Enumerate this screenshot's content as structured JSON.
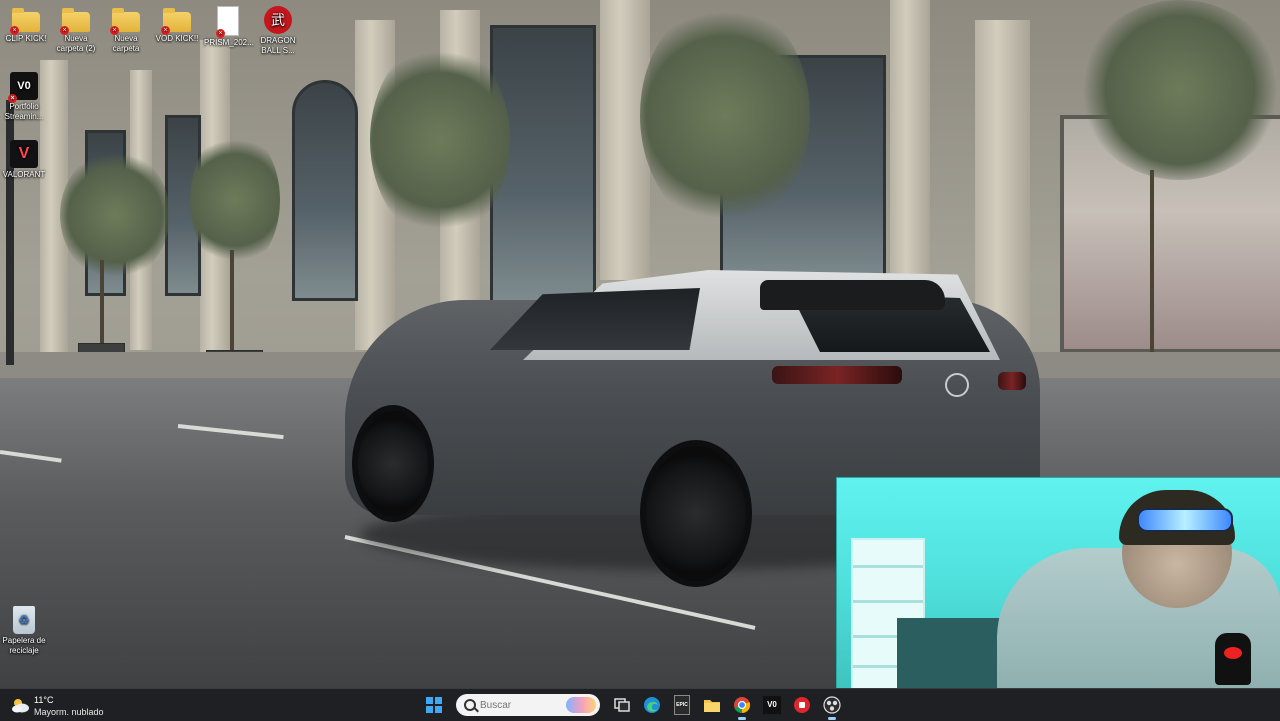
{
  "desktop": {
    "icons": [
      {
        "label": "CLIP KICK!",
        "type": "folder"
      },
      {
        "label": "Nueva carpeta (2)",
        "type": "folder"
      },
      {
        "label": "Nueva carpeta",
        "type": "folder"
      },
      {
        "label": "VOD KICK!!",
        "type": "folder"
      },
      {
        "label": "PRISM_202...",
        "type": "document"
      },
      {
        "label": "DRAGON BALL S...",
        "type": "app"
      },
      {
        "label": "Portfolio Streamin...",
        "type": "app"
      },
      {
        "label": "VALORANT",
        "type": "app"
      },
      {
        "label": "Papelera de reciclaje",
        "type": "recycle-bin"
      }
    ],
    "icon_glyphs": {
      "portfolio": "V0",
      "dragon": "武",
      "valorant": "V",
      "bin": "♻"
    }
  },
  "taskbar": {
    "weather": {
      "temp": "11°C",
      "condition": "Mayorm. nublado"
    },
    "search": {
      "placeholder": "Buscar"
    },
    "apps": [
      "task-view",
      "edge",
      "epic-games",
      "file-explorer",
      "chrome",
      "portfolio-streaming",
      "record-app",
      "obs"
    ],
    "epic_label": "EPIC"
  },
  "colors": {
    "taskbar_bg": "#1c1e21",
    "webcam_bg": "#5ff2ee",
    "accent": "#3fa9f5"
  }
}
